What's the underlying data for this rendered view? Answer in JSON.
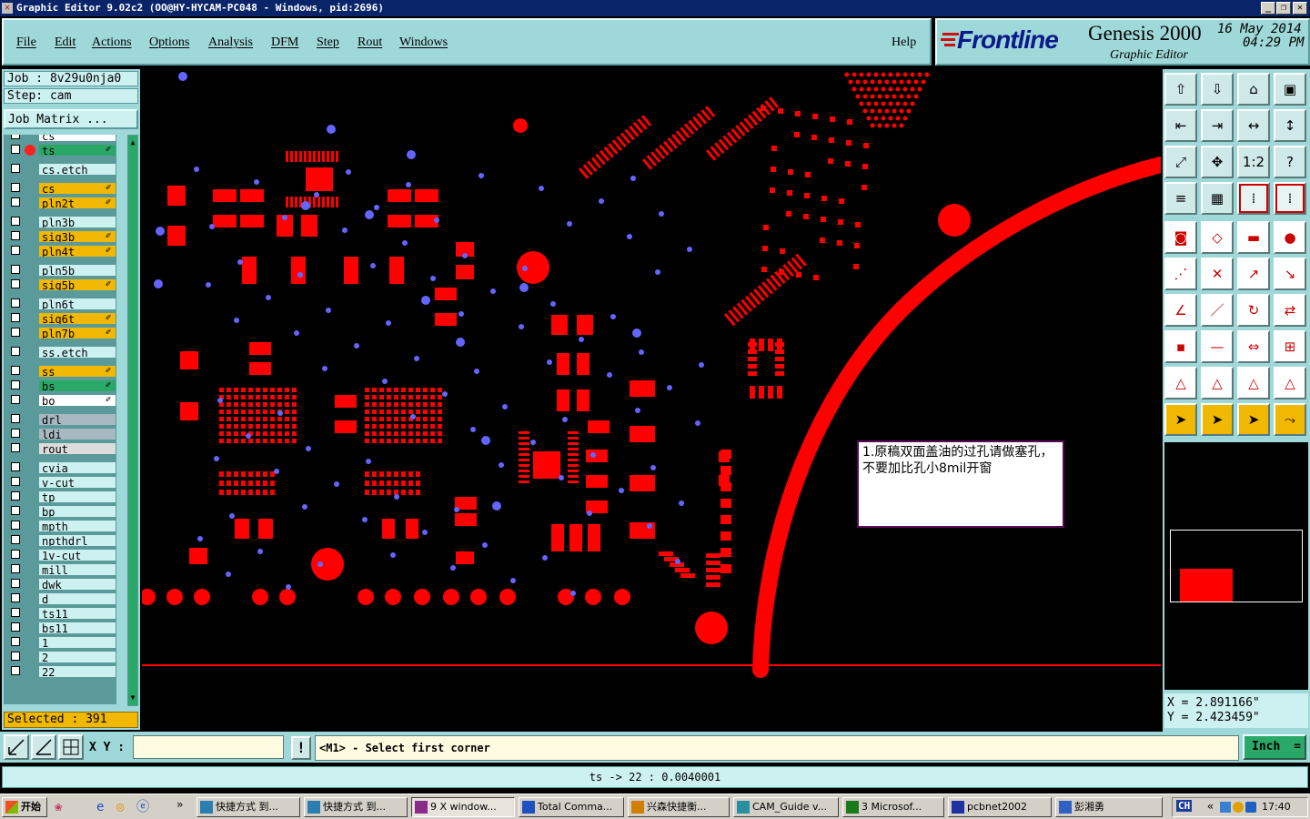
{
  "window": {
    "title": "Graphic Editor 9.02c2 (OO@HY-HYCAM-PC048 - Windows, pid:2696)",
    "controls": [
      "_",
      "❐",
      "✕"
    ]
  },
  "menu": [
    "File",
    "Edit",
    "Actions",
    "Options",
    "Analysis",
    "DFM",
    "Step",
    "Rout",
    "Windows"
  ],
  "help_label": "Help",
  "brand": {
    "logo": "Frontline",
    "product": "Genesis 2000",
    "subtitle": "Graphic Editor",
    "date": "16 May 2014",
    "time": "04:29 PM"
  },
  "job": {
    "job_label": "Job : 8v29u0nja0",
    "step_label": "Step: cam",
    "matrix_button": "Job Matrix ..."
  },
  "layers": [
    {
      "name": "cs",
      "color": "#ffffff",
      "partial": true
    },
    {
      "name": "ts",
      "color": "#2aa868",
      "affected": true,
      "active": true
    },
    {
      "name": "cs.etch",
      "color": "#cdf0f0"
    },
    {
      "name": "cs",
      "color": "#f0b800",
      "affected": true
    },
    {
      "name": "pln2t",
      "color": "#f0b800",
      "affected": true
    },
    {
      "name": "pln3b",
      "color": "#cdf0f0"
    },
    {
      "name": "sig3b",
      "color": "#f0b800",
      "affected": true
    },
    {
      "name": "pln4t",
      "color": "#f0b800",
      "affected": true
    },
    {
      "name": "pln5b",
      "color": "#cdf0f0"
    },
    {
      "name": "sig5b",
      "color": "#f0b800",
      "affected": true
    },
    {
      "name": "pln6t",
      "color": "#cdf0f0"
    },
    {
      "name": "sig6t",
      "color": "#f0b800",
      "affected": true
    },
    {
      "name": "pln7b",
      "color": "#f0b800",
      "affected": true
    },
    {
      "name": "ss.etch",
      "color": "#cdf0f0"
    },
    {
      "name": "ss",
      "color": "#f0b800",
      "affected": true
    },
    {
      "name": "bs",
      "color": "#2aa868",
      "affected": true
    },
    {
      "name": "bo",
      "color": "#ffffff",
      "affected": true
    },
    {
      "name": "drl",
      "color": "#a8b8c0"
    },
    {
      "name": "ldi",
      "color": "#a8b8c0"
    },
    {
      "name": "rout",
      "color": "#dcdcdc"
    },
    {
      "name": "cvia",
      "color": "#cdf0f0"
    },
    {
      "name": "v-cut",
      "color": "#cdf0f0"
    },
    {
      "name": "tp",
      "color": "#cdf0f0"
    },
    {
      "name": "bp",
      "color": "#cdf0f0"
    },
    {
      "name": "mpth",
      "color": "#cdf0f0"
    },
    {
      "name": "npthdrl",
      "color": "#cdf0f0"
    },
    {
      "name": "1v-cut",
      "color": "#cdf0f0"
    },
    {
      "name": "mill",
      "color": "#cdf0f0"
    },
    {
      "name": "dwk",
      "color": "#cdf0f0"
    },
    {
      "name": "d",
      "color": "#cdf0f0"
    },
    {
      "name": "ts11",
      "color": "#cdf0f0"
    },
    {
      "name": "bs11",
      "color": "#cdf0f0"
    },
    {
      "name": "1",
      "color": "#cdf0f0"
    },
    {
      "name": "2",
      "color": "#cdf0f0"
    },
    {
      "name": "22",
      "color": "#cdf0f0"
    }
  ],
  "selected_label": "Selected : 391",
  "note_text": "1.原稿双面盖油的过孔请做塞孔，不要加比孔小8mil开窗",
  "coords": {
    "x": "X = 2.891166\"",
    "y": "Y = 2.423459\""
  },
  "command": {
    "xy_label": "X Y :",
    "xy_value": "",
    "prompt": "<M1> - Select first corner",
    "units": "Inch",
    "warn": "!"
  },
  "status_text": "ts -> 22 : 0.0040001",
  "toolbar_icons": [
    "zoom-home-icon",
    "zoom-step-icon",
    "home-icon",
    "window-icon",
    "pan-left-icon",
    "pan-right-icon",
    "zoom-in-icon",
    "zoom-out-icon",
    "fit-icon",
    "center-icon",
    "scale-1-2-icon",
    "help-icon",
    "measure-icon",
    "grid-icon",
    "snap-icon",
    "snap-2-icon",
    "pad-icon",
    "outline-icon",
    "ruler-icon",
    "dot-icon",
    "nodes-icon",
    "cross-icon",
    "move-icon",
    "copy-icon",
    "angle-icon",
    "line-icon",
    "arc-icon",
    "flip-icon",
    "feature-icon",
    "minus-icon",
    "resize-icon",
    "group-icon",
    "polygon-icon",
    "polygon-2-icon",
    "polygon-3-icon",
    "polygon-4-icon",
    "select-icon",
    "select-2-icon",
    "select-3-icon",
    "route-icon"
  ],
  "taskbar": {
    "start": "开始",
    "tasks": [
      "快捷方式 到...",
      "快捷方式 到...",
      "9 X window...",
      "Total Comma...",
      "兴森快捷衡...",
      "CAM_Guide v...",
      "3 Microsof...",
      "pcbnet2002",
      "彭湘勇"
    ],
    "tray_lang": "CH",
    "clock": "17:40"
  },
  "colors": {
    "accent": "#9fd8d8",
    "copper": "#ff0000",
    "via": "#6464ff"
  }
}
